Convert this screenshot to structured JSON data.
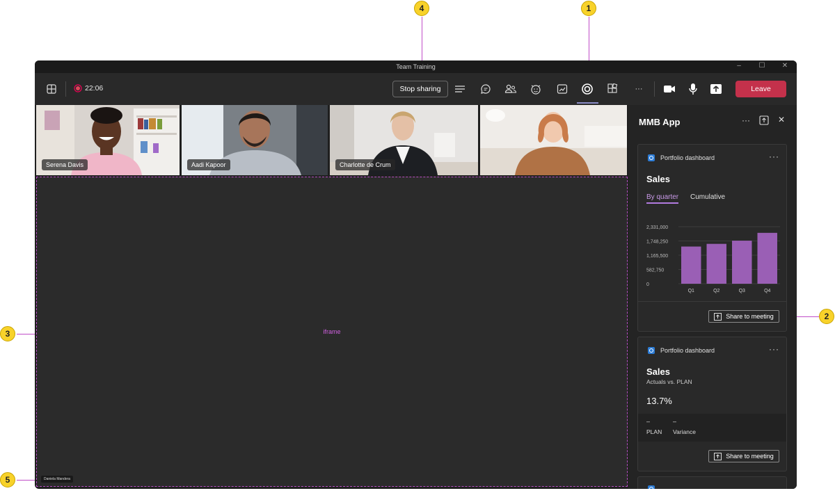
{
  "window": {
    "title": "Team Training"
  },
  "toolbar": {
    "timer": "22:06",
    "stop_sharing_label": "Stop sharing",
    "leave_label": "Leave",
    "more_label": "···"
  },
  "participants": [
    {
      "name": "Serena Davis"
    },
    {
      "name": "Aadi Kapoor"
    },
    {
      "name": "Charlotte de Crum"
    },
    {
      "name": ""
    }
  ],
  "stage": {
    "label": "iframe",
    "presenter": "Daniela Mandera"
  },
  "panel": {
    "title": "MMB App",
    "more_label": "···",
    "cards": [
      {
        "app_name": "Portfolio dashboard",
        "more_label": "···",
        "title": "Sales",
        "tabs": [
          "By quarter",
          "Cumulative"
        ],
        "active_tab": "By quarter",
        "share_label": "Share to meeting"
      },
      {
        "app_name": "Portfolio dashboard",
        "more_label": "···",
        "title": "Sales",
        "subtitle": "Actuals vs. PLAN",
        "percent": "13.7%",
        "plan_value": "–",
        "plan_label": "PLAN",
        "variance_value": "–",
        "variance_label": "Variance",
        "share_label": "Share to meeting"
      }
    ]
  },
  "callouts": [
    "1",
    "2",
    "3",
    "4",
    "5"
  ],
  "colors": {
    "leave": "#c4314b",
    "accent": "#b27be0",
    "bar": "#9a5fb5",
    "callout": "#f8d22a"
  },
  "chart_data": {
    "type": "bar",
    "categories": [
      "Q1",
      "Q2",
      "Q3",
      "Q4"
    ],
    "values": [
      1520000,
      1630000,
      1760000,
      2080000
    ],
    "ylim": [
      0,
      2331000
    ],
    "y_ticks": [
      "2,331,000",
      "1,748,250",
      "1,165,500",
      "582,750",
      "0"
    ],
    "y_tick_values": [
      2331000,
      1748250,
      1165500,
      582750,
      0
    ],
    "grid": true
  }
}
